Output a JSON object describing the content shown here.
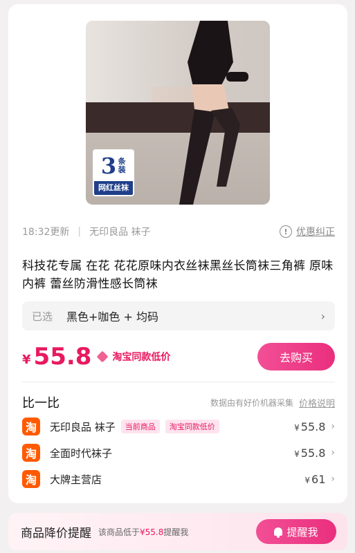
{
  "product": {
    "badge_number": "3",
    "badge_unit": "条装",
    "badge_label": "网红丝袜",
    "updated_time": "18:32更新",
    "brand": "无印良品 袜子",
    "correction_link": "优惠纠正",
    "title": "科技花专属  在花  花花原味内衣丝袜黑丝长筒袜三角裤  原味内裤  蕾丝防滑性感长筒袜"
  },
  "selection": {
    "label": "已选",
    "value": "黑色+咖色 + 均码"
  },
  "price": {
    "currency": "¥",
    "amount": "55.8",
    "low_tag": "淘宝同款低价",
    "buy_button": "去购买"
  },
  "compare": {
    "title": "比一比",
    "note": "数据由有好价机器采集",
    "link": "价格说明",
    "stores": [
      {
        "icon": "淘",
        "name": "无印良品 袜子",
        "tags": [
          "当前商品",
          "淘宝同款低价"
        ],
        "price": "55.8"
      },
      {
        "icon": "淘",
        "name": "全面时代袜子",
        "tags": [],
        "price": "55.8"
      },
      {
        "icon": "淘",
        "name": "大牌主营店",
        "tags": [],
        "price": "61"
      }
    ]
  },
  "reminder": {
    "title": "商品降价提醒",
    "desc_prefix": "该商品低于",
    "desc_price": "¥55.8",
    "desc_suffix": "提醒我",
    "button": "提醒我"
  },
  "colors": {
    "accent": "#e8195f",
    "taobao": "#ff5a00"
  }
}
